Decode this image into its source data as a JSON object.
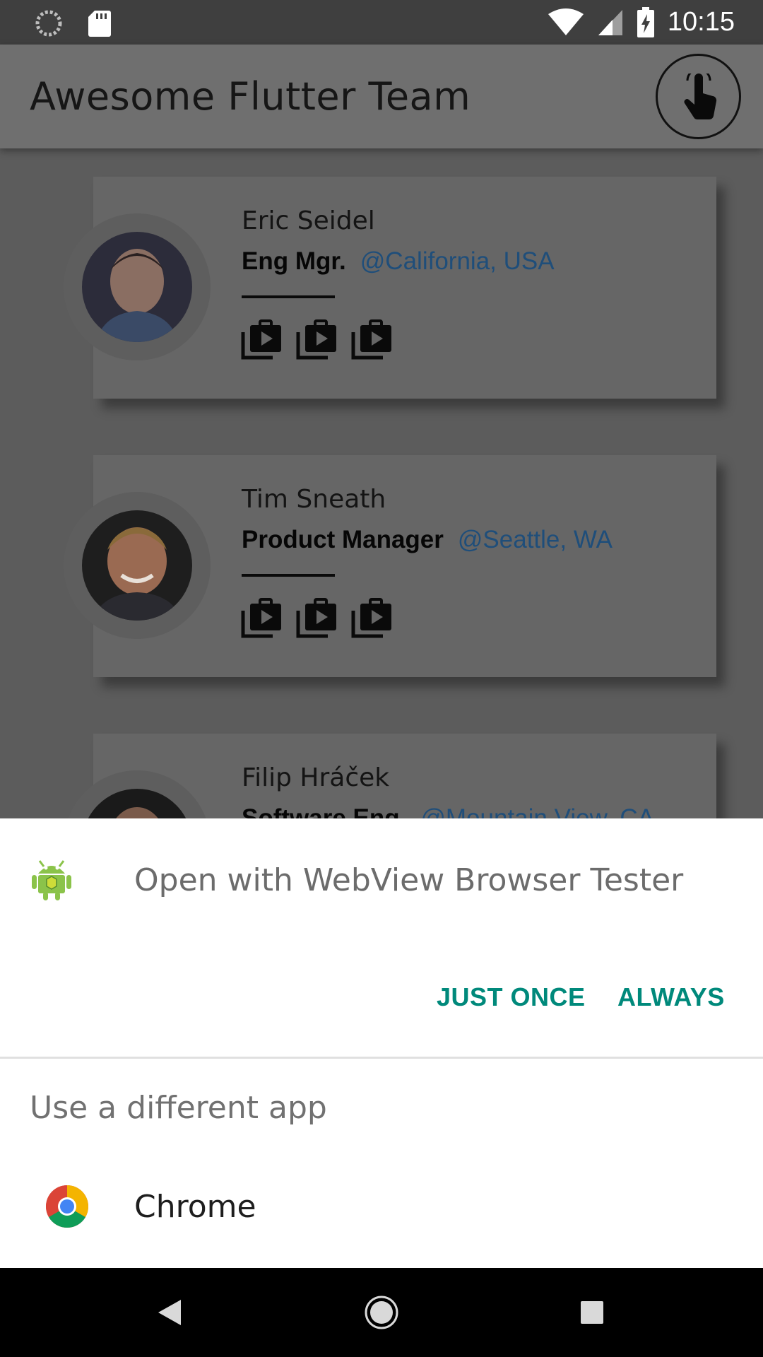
{
  "status_bar": {
    "time": "10:15",
    "icons": [
      "loading-icon",
      "sd-card-icon",
      "wifi-icon",
      "cell-signal-icon",
      "battery-charging-icon"
    ]
  },
  "app_bar": {
    "title": "Awesome Flutter Team",
    "action_icon": "touch-app-icon"
  },
  "team": [
    {
      "name": "Eric Seidel",
      "role": "Eng Mgr.",
      "location": "@California, USA"
    },
    {
      "name": "Tim Sneath",
      "role": "Product Manager",
      "location": "@Seattle, WA"
    },
    {
      "name": "Filip Hráček",
      "role": "Software Eng.",
      "location": "@Mountain View, CA"
    }
  ],
  "dialog": {
    "title": "Open with WebView Browser Tester",
    "app_icon": "android-app-icon",
    "just_once": "JUST ONCE",
    "always": "ALWAYS",
    "other_header": "Use a different app",
    "other_apps": [
      {
        "label": "Chrome",
        "icon": "chrome-icon"
      }
    ]
  },
  "nav_bar": {
    "buttons": [
      "back-icon",
      "home-icon",
      "recents-icon"
    ]
  },
  "colors": {
    "accent": "#00897b",
    "location_link": "#1f4e7a",
    "scrim": "#5c5c5c",
    "sheet_bg": "#ffffff"
  }
}
